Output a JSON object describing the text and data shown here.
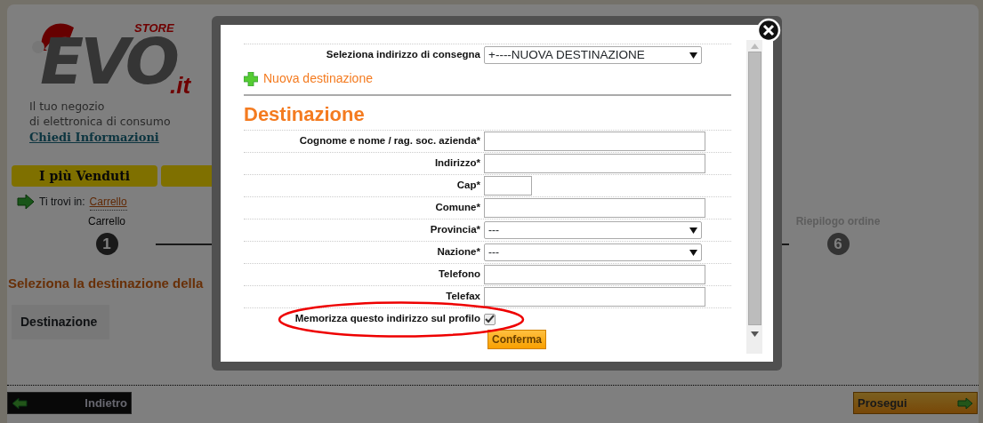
{
  "page": {
    "logo": {
      "brand": "EVO",
      "store": "STORE",
      "tld": ".it"
    },
    "tagline": [
      "Il tuo negozio",
      "di elettronica di consumo"
    ],
    "info_link": "Chiedi Informazioni",
    "menu_tabs": [
      "I più Venduti"
    ],
    "breadcrumb": {
      "label": "Ti trovi in:",
      "link": "Carrello"
    },
    "steps": [
      {
        "label": "Carrello",
        "number": "1",
        "selected": true
      },
      {
        "label": "Riepilogo ordine",
        "number": "6",
        "selected": false
      }
    ],
    "section_title": "Seleziona la destinazione della",
    "table_header": "Destinazione",
    "back_button": "Indietro",
    "next_button": "Prosegui"
  },
  "modal": {
    "address_select": {
      "label": "Seleziona indirizzo di consegna",
      "value": "+----NUOVA DESTINAZIONE"
    },
    "new_link": "Nuova destinazione",
    "heading": "Destinazione",
    "fields": [
      {
        "label": "Cognome e nome / rag. soc. azienda*",
        "kind": "text"
      },
      {
        "label": "Indirizzo*",
        "kind": "text"
      },
      {
        "label": "Cap*",
        "kind": "short"
      },
      {
        "label": "Comune*",
        "kind": "text"
      },
      {
        "label": "Provincia*",
        "kind": "select",
        "value": "---"
      },
      {
        "label": "Nazione*",
        "kind": "select",
        "value": "---"
      },
      {
        "label": "Telefono",
        "kind": "text"
      },
      {
        "label": "Telefax",
        "kind": "text"
      }
    ],
    "save_profile": {
      "label": "Memorizza questo indirizzo sul profilo",
      "checked": true,
      "highlighted": true
    },
    "confirm_button": "Conferma"
  }
}
